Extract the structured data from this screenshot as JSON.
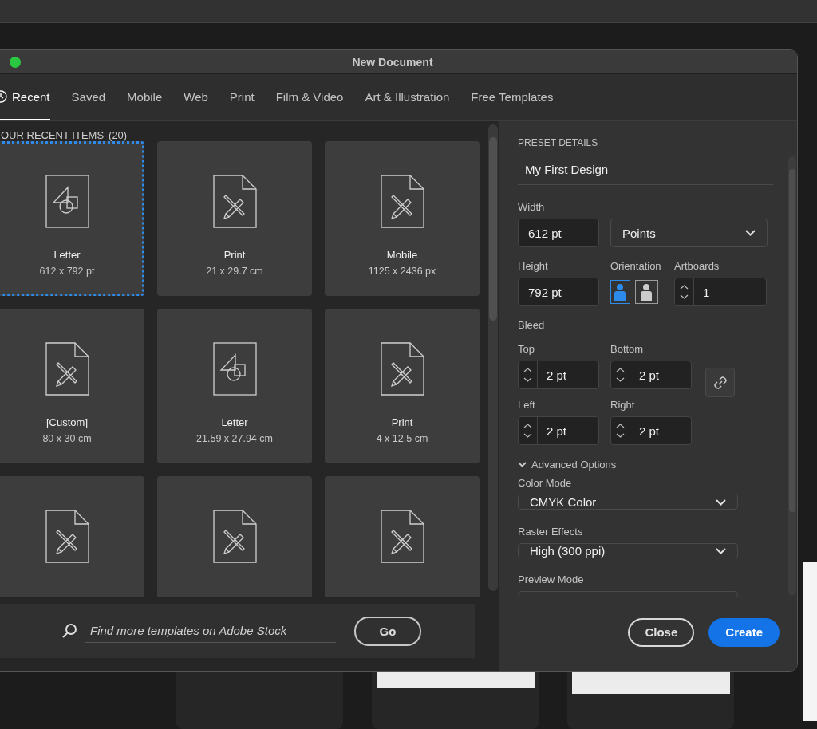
{
  "window": {
    "title": "New Document"
  },
  "tabs": [
    {
      "label": "Recent",
      "selected": true,
      "kind": "clock"
    },
    {
      "label": "Saved",
      "selected": false,
      "kind": "text"
    },
    {
      "label": "Mobile",
      "selected": false,
      "kind": "text"
    },
    {
      "label": "Web",
      "selected": false,
      "kind": "text"
    },
    {
      "label": "Print",
      "selected": false,
      "kind": "text"
    },
    {
      "label": "Film & Video",
      "selected": false,
      "kind": "text"
    },
    {
      "label": "Art & Illustration",
      "selected": false,
      "kind": "text"
    },
    {
      "label": "Free Templates",
      "selected": false,
      "kind": "text"
    }
  ],
  "recent": {
    "heading": "OUR RECENT ITEMS",
    "count": "(20)",
    "items": [
      {
        "name": "Letter",
        "size": "612 x 792 pt",
        "kind": "shapes",
        "selected": true
      },
      {
        "name": "Print",
        "size": "21 x 29.7 cm",
        "kind": "ruler",
        "selected": false
      },
      {
        "name": "Mobile",
        "size": "1125 x 2436 px",
        "kind": "ruler",
        "selected": false
      },
      {
        "name": "[Custom]",
        "size": "80 x 30 cm",
        "kind": "ruler",
        "selected": false
      },
      {
        "name": "Letter",
        "size": "21.59 x 27.94 cm",
        "kind": "shapes",
        "selected": false
      },
      {
        "name": "Print",
        "size": "4 x 12.5 cm",
        "kind": "ruler",
        "selected": false
      },
      {
        "kind": "ruler",
        "selected": false
      },
      {
        "kind": "ruler",
        "selected": false
      },
      {
        "kind": "ruler",
        "selected": false
      }
    ]
  },
  "search": {
    "placeholder": "Find more templates on Adobe Stock",
    "button": "Go"
  },
  "preset": {
    "heading": "PRESET DETAILS",
    "name": "My First Design",
    "width": {
      "label": "Width",
      "value": "612 pt"
    },
    "units": "Points",
    "height": {
      "label": "Height",
      "value": "792 pt"
    },
    "orientation": {
      "label": "Orientation",
      "options": [
        {
          "kind": "portrait",
          "selected": true
        },
        {
          "kind": "landscape",
          "selected": false
        }
      ]
    },
    "artboards": {
      "label": "Artboards",
      "value": "1"
    },
    "bleed": {
      "label": "Bleed",
      "fields": [
        {
          "label": "Top",
          "value": "2 pt"
        },
        {
          "label": "Bottom",
          "value": "2 pt"
        },
        {
          "label": "Left",
          "value": "2 pt"
        },
        {
          "label": "Right",
          "value": "2 pt"
        }
      ]
    },
    "advanced": {
      "label": "Advanced Options",
      "expanded": true
    },
    "color_mode": {
      "label": "Color Mode",
      "value": "CMYK Color"
    },
    "raster": {
      "label": "Raster Effects",
      "value": "High (300 ppi)"
    },
    "preview": {
      "label": "Preview Mode"
    }
  },
  "buttons": [
    {
      "label": "Close",
      "kind": "secondary"
    },
    {
      "label": "Create",
      "kind": "primary"
    }
  ]
}
